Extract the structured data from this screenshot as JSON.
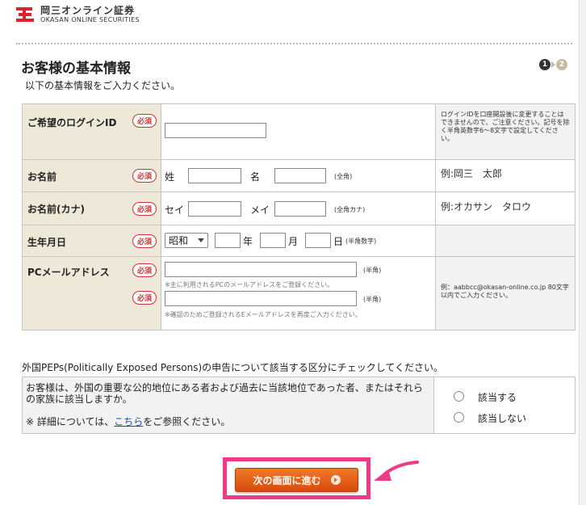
{
  "brand": {
    "name_jp": "岡三オンライン証券",
    "name_en": "OKASAN ONLINE SECURITIES"
  },
  "page": {
    "title": "お客様の基本情報",
    "intro": "以下の基本情報をご入力ください。"
  },
  "steps": [
    {
      "label": "1",
      "active": true
    },
    {
      "label": "2",
      "active": false
    }
  ],
  "required_label": "必須",
  "form": {
    "login_id": {
      "label": "ご希望のログインID",
      "value": "",
      "note": "ログインIDを口座開設後に変更することはできませんので、ご注意ください。記号を除く半角英数字6～8文字で設定してください。"
    },
    "name": {
      "label": "お名前",
      "sei_label": "姓",
      "mei_label": "名",
      "sei_value": "",
      "mei_value": "",
      "suffix": "(全角)",
      "example": "例:岡三　太郎"
    },
    "name_kana": {
      "label": "お名前(カナ)",
      "sei_label": "セイ",
      "mei_label": "メイ",
      "sei_value": "",
      "mei_value": "",
      "suffix": "(全角カナ)",
      "example": "例:オカサン　タロウ"
    },
    "birthdate": {
      "label": "生年月日",
      "era": "昭和",
      "year_label": "年",
      "month_label": "月",
      "day_label": "日",
      "suffix": "(半角数字)",
      "year_value": "",
      "month_value": "",
      "day_value": ""
    },
    "email": {
      "label": "PCメールアドレス",
      "value": "",
      "confirm_value": "",
      "suffix": "(半角)",
      "hint": "※主に利用されるPCのメールアドレスをご登録ください。",
      "confirm_hint": "※確認のためご登録されるEメールアドレスを再度ご入力ください。",
      "note": "例：aabbcc@okasan-online.co.jp 80文字以内でご入力ください。"
    }
  },
  "pep": {
    "title": "外国PEPs(Politically Exposed Persons)の申告について該当する区分にチェックしてください。",
    "question": "お客様は、外国の重要な公的地位にある者および過去に当該地位であった者、またはそれらの家族に該当しますか。",
    "detail_prefix": "※ 詳細については、",
    "detail_link": "こちら",
    "detail_suffix": "をご参照ください。",
    "options": [
      "該当する",
      "該当しない"
    ]
  },
  "submit_label": "次の画面に進む",
  "colors": {
    "accent": "#e2661c",
    "highlight": "#ee3a88",
    "label_bg": "#ede8d8",
    "required": "#cc3333"
  }
}
